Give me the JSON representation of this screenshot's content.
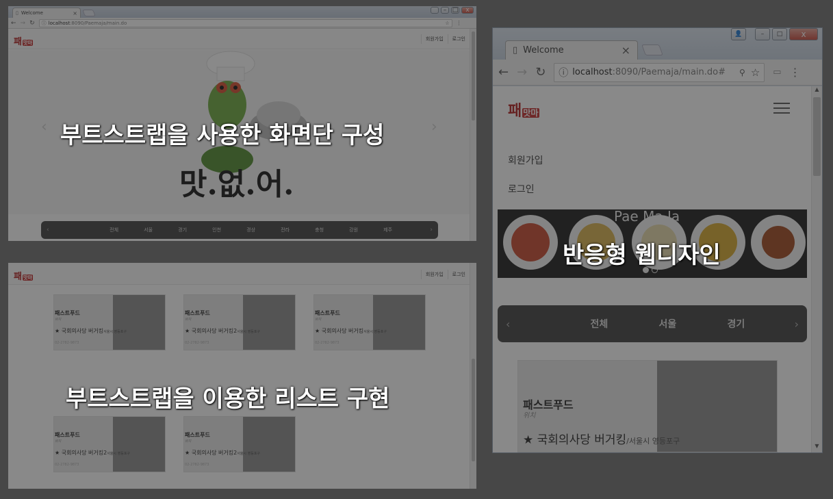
{
  "browser": {
    "tab_title": "Welcome",
    "tab_close": "×",
    "url_host": "localhost",
    "url_path_main": ":8090/Paemaja/main.do",
    "url_path_hash": ":8090/Paemaja/main.do#"
  },
  "site": {
    "logo_text": "패",
    "logo_sub": "맛마",
    "signup": "회원가입",
    "login": "로그인",
    "hero_text": "맛.없.어.",
    "brand_watermark": "Pae Ma Ja"
  },
  "regions": [
    "전체",
    "서울",
    "경기",
    "인천",
    "경상",
    "전라",
    "충청",
    "강원",
    "제주"
  ],
  "regions_mobile": [
    "전체",
    "서울",
    "경기"
  ],
  "arrows": {
    "prev": "‹",
    "next": "›"
  },
  "cards": [
    {
      "category": "패스트푸드",
      "sub": "위치",
      "name": "★ 국회의사당 버거킹",
      "addr": "서울시 영등포구",
      "tel": "02-2782-9873"
    },
    {
      "category": "패스트푸드",
      "sub": "위치",
      "name": "★ 국회의사당 버거킹2",
      "addr": "서울시 영등포구",
      "tel": "02-2782-9873"
    },
    {
      "category": "패스트푸드",
      "sub": "위치",
      "name": "★ 국회의사당 버거킹",
      "addr": "서울시 영등포구",
      "tel": "02-2782-9873"
    },
    {
      "category": "패스트푸드",
      "sub": "위치",
      "name": "★ 국회의사당 버거킹2",
      "addr": "서울시 영등포구",
      "tel": "02-2782-9873"
    },
    {
      "category": "패스트푸드",
      "sub": "위치",
      "name": "★ 국회의사당 버거킹2",
      "addr": "서울시 영등포구",
      "tel": "02-2782-9873"
    }
  ],
  "mobile_card": {
    "category": "패스트푸드",
    "sub": "위치",
    "name": "★ 국회의사당 버거킹",
    "addr": "/서울시 영등포구"
  },
  "captions": {
    "bootstrap_screen": "부트스트랩을 사용한 화면단 구성",
    "bootstrap_list": "부트스트랩을 이용한 리스트 구현",
    "responsive": "반응형 웹디자인"
  },
  "colors": {
    "accent": "#b01818",
    "bar": "#3c3c3c"
  }
}
